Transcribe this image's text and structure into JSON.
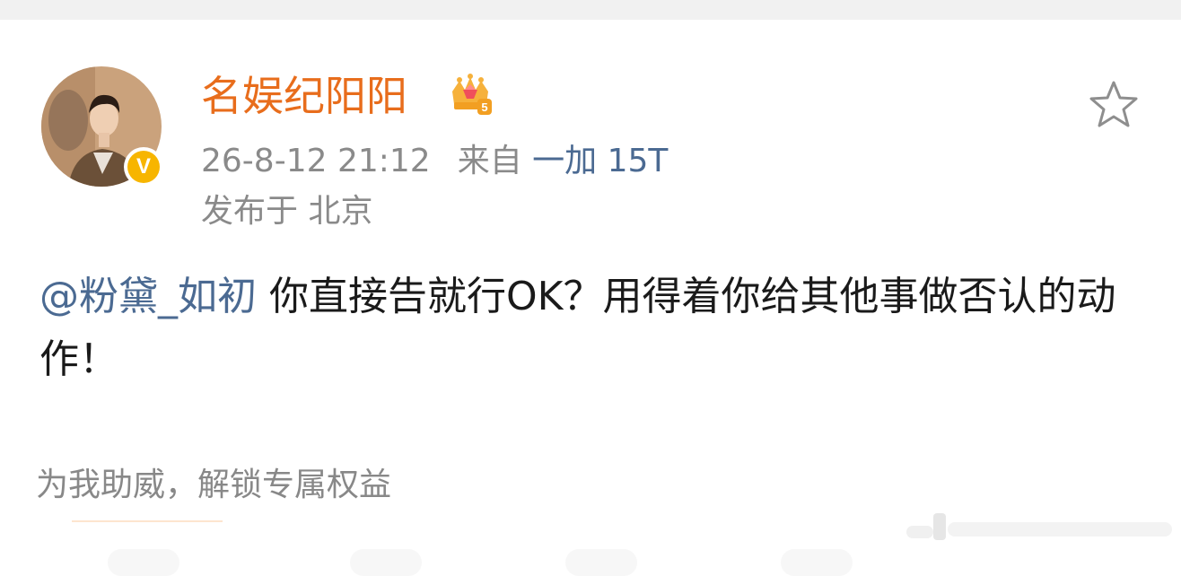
{
  "post": {
    "author": {
      "name": "名娱纪阳阳",
      "vip_level": "5",
      "verified_mark": "V"
    },
    "meta": {
      "time": "26-8-12 21:12",
      "source_prefix": "来自",
      "device": "一加 15T",
      "location": "发布于 北京"
    },
    "content": {
      "mention": "@粉黛_如初",
      "text": " 你直接告就行OK？用得着你给其他事做否认的动作！"
    },
    "support_link": "为我助威，解锁专属权益"
  },
  "colors": {
    "username": "#e86d1c",
    "link": "#4b6a92",
    "meta": "#8a8a8a",
    "body_text": "#1a1a1a",
    "verified_badge": "#f7b500"
  },
  "icons": {
    "favorite": "star-outline-icon",
    "vip": "crown-icon",
    "verified": "verified-v-icon"
  }
}
